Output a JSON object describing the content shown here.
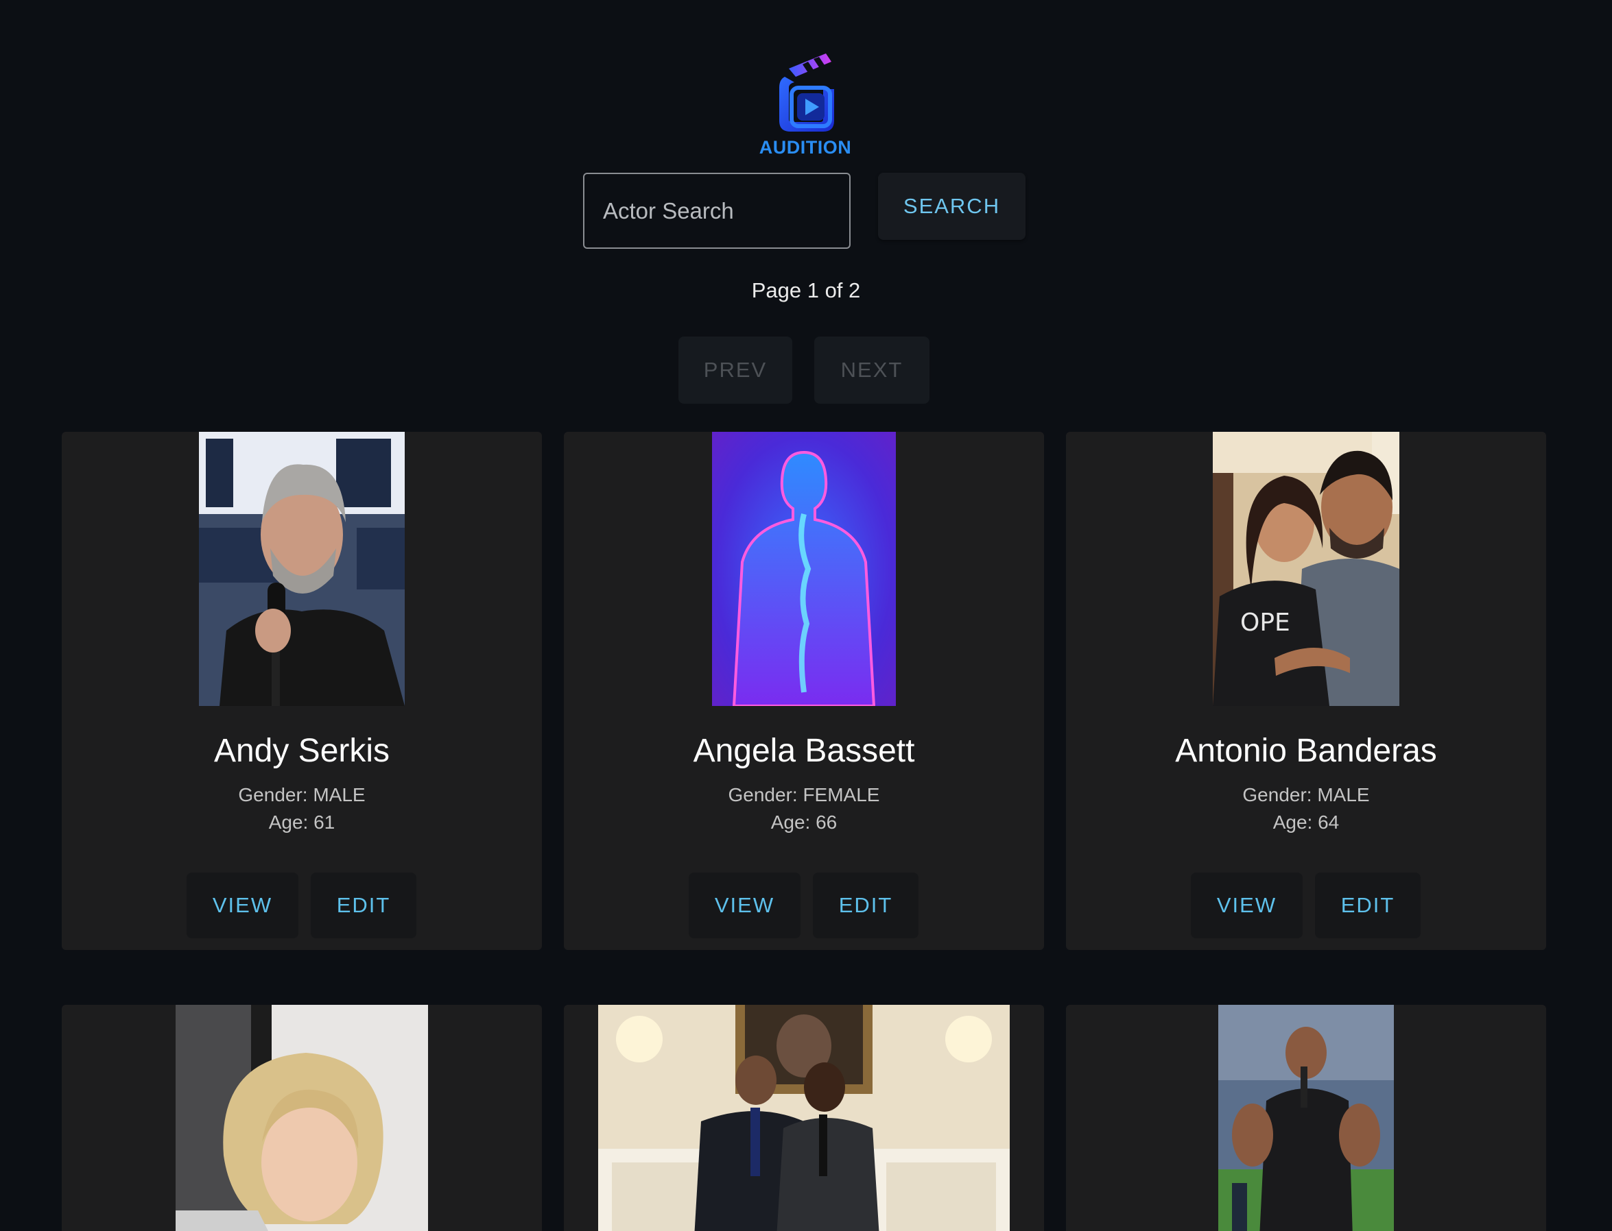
{
  "app": {
    "logo_text": "AUDITION"
  },
  "search": {
    "placeholder": "Actor Search",
    "value": "",
    "button_label": "SEARCH"
  },
  "pagination": {
    "indicator": "Page 1 of 2",
    "prev_label": "PREV",
    "next_label": "NEXT"
  },
  "actors": [
    {
      "name": "Andy Serkis",
      "gender": "Gender: MALE",
      "age": "Age: 61",
      "view_label": "VIEW",
      "edit_label": "EDIT",
      "photo": "photo-man-with-microphone"
    },
    {
      "name": "Angela Bassett",
      "gender": "Gender: FEMALE",
      "age": "Age: 66",
      "view_label": "VIEW",
      "edit_label": "EDIT",
      "photo": "placeholder-silhouette"
    },
    {
      "name": "Antonio Banderas",
      "gender": "Gender: MALE",
      "age": "Age: 64",
      "view_label": "VIEW",
      "edit_label": "EDIT",
      "photo": "photo-man-hugging-girl"
    },
    {
      "name": "",
      "photo": "photo-blonde-woman"
    },
    {
      "name": "",
      "photo": "photo-two-men-in-suits"
    },
    {
      "name": "",
      "photo": "photo-man-on-stadium-field"
    }
  ],
  "colors": {
    "background": "#0c0f14",
    "card": "#1d1d1e",
    "accent": "#5ec1ec",
    "logo": "#2a8df2",
    "disabled": "#4d5156"
  }
}
